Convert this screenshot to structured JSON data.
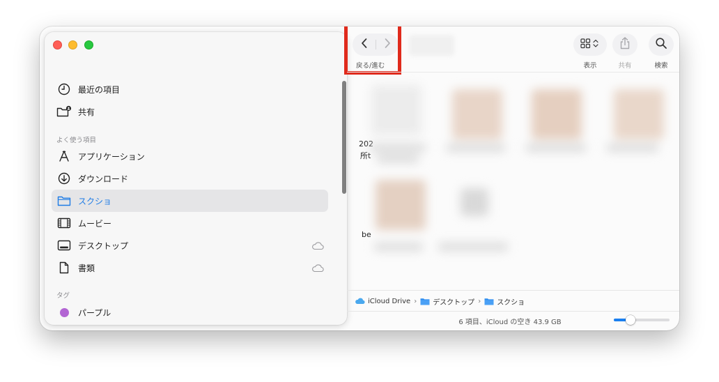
{
  "sidebar": {
    "recents_label": "最近の項目",
    "shared_label": "共有",
    "favorites_heading": "よく使う項目",
    "favorites": [
      {
        "label": "アプリケーション",
        "icon": "applications-icon"
      },
      {
        "label": "ダウンロード",
        "icon": "download-icon"
      },
      {
        "label": "スクショ",
        "icon": "folder-icon",
        "selected": true
      },
      {
        "label": "ムービー",
        "icon": "film-icon"
      },
      {
        "label": "デスクトップ",
        "icon": "desktop-icon",
        "icloud": true
      },
      {
        "label": "書類",
        "icon": "document-icon",
        "icloud": true
      }
    ],
    "tags_heading": "タグ",
    "tags": [
      {
        "label": "パープル",
        "color": "#b265d3"
      }
    ]
  },
  "toolbar": {
    "nav_caption": "戻る/進む",
    "view_caption": "表示",
    "share_caption": "共有",
    "search_caption": "検索"
  },
  "content": {
    "peek_texts": [
      "202",
      "所t",
      "be"
    ]
  },
  "pathbar": {
    "items": [
      "iCloud Drive",
      "デスクトップ",
      "スクショ"
    ]
  },
  "status": {
    "text": "6 項目、iCloud の空き 43.9 GB",
    "icon_size_fraction": 0.3
  },
  "colors": {
    "accent": "#1e7ce6",
    "highlight_border": "#e02a1c",
    "close": "#ff5f57",
    "minimize": "#febc2e",
    "zoom": "#28c840"
  }
}
